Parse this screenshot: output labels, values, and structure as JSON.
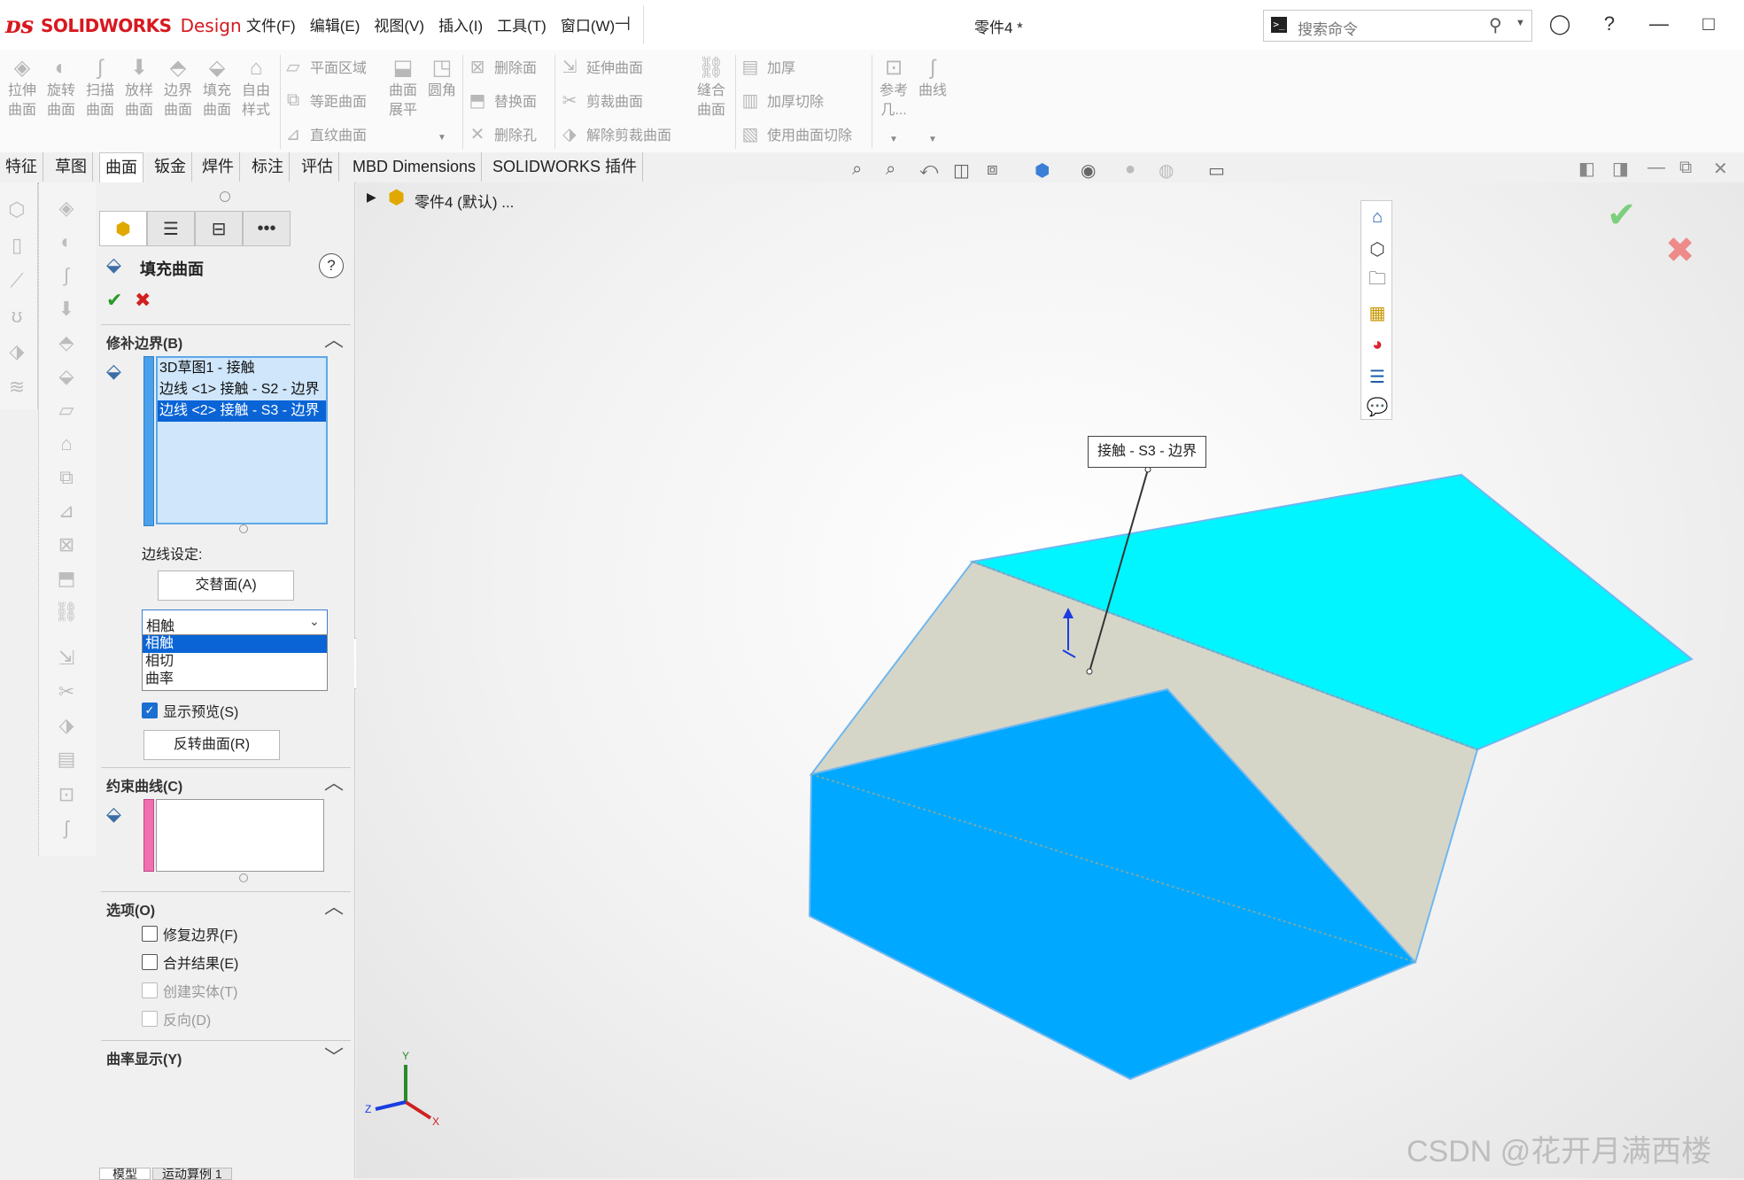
{
  "app": {
    "logo_brand": "SOLIDWORKS",
    "logo_suffix": "Design",
    "document_title": "零件4 *"
  },
  "menu": [
    "文件(F)",
    "编辑(E)",
    "视图(V)",
    "插入(I)",
    "工具(T)",
    "窗口(W)"
  ],
  "search": {
    "placeholder": "搜索命令"
  },
  "ribbon": {
    "big": [
      {
        "l1": "拉伸",
        "l2": "曲面",
        "icon": "extrude-surface-icon"
      },
      {
        "l1": "旋转",
        "l2": "曲面",
        "icon": "revolve-surface-icon"
      },
      {
        "l1": "扫描",
        "l2": "曲面",
        "icon": "sweep-surface-icon"
      },
      {
        "l1": "放样",
        "l2": "曲面",
        "icon": "loft-surface-icon"
      },
      {
        "l1": "边界",
        "l2": "曲面",
        "icon": "boundary-surface-icon"
      },
      {
        "l1": "填充",
        "l2": "曲面",
        "icon": "fill-surface-icon"
      },
      {
        "l1": "自由",
        "l2": "样式",
        "icon": "freeform-icon"
      }
    ],
    "col_a": [
      "平面区域",
      "等距曲面",
      "直纹曲面"
    ],
    "extra_big": [
      {
        "l1": "曲面",
        "l2": "展平",
        "icon": "flatten-icon"
      },
      {
        "l1": "圆角",
        "l2": "",
        "icon": "fillet-icon"
      }
    ],
    "col_b": [
      "删除面",
      "替换面",
      "删除孔"
    ],
    "col_c": [
      "延伸曲面",
      "剪裁曲面",
      "解除剪裁曲面"
    ],
    "knit": {
      "l1": "缝合",
      "l2": "曲面"
    },
    "col_d": [
      "加厚",
      "加厚切除",
      "使用曲面切除"
    ],
    "ref": {
      "l1": "参考",
      "l2": "几..."
    },
    "curves": {
      "l1": "曲线",
      "l2": ""
    }
  },
  "tabs": [
    "特征",
    "草图",
    "曲面",
    "钣金",
    "焊件",
    "标注",
    "评估",
    "MBD Dimensions",
    "SOLIDWORKS 插件"
  ],
  "active_tab": "曲面",
  "tree": {
    "label": "零件4 (默认) ..."
  },
  "pm": {
    "title": "填充曲面",
    "help": "?",
    "ok": "✔",
    "cancel": "✖",
    "sec_boundary": "修补边界(B)",
    "boundary_items": [
      "3D草图1 - 接触",
      "边线 <1> 接触 - S2 - 边界",
      "边线 <2> 接触 - S3 - 边界"
    ],
    "edge_settings": "边线设定:",
    "alt_face_btn": "交替面(A)",
    "combo_value": "相触",
    "combo_options": [
      "相触",
      "相切",
      "曲率"
    ],
    "show_preview": "显示预览(S)",
    "flip_btn": "反转曲面(R)",
    "sec_constraint": "约束曲线(C)",
    "sec_options": "选项(O)",
    "options": [
      {
        "label": "修复边界(F)",
        "enabled": true
      },
      {
        "label": "合并结果(E)",
        "enabled": true
      },
      {
        "label": "创建实体(T)",
        "enabled": false
      },
      {
        "label": "反向(D)",
        "enabled": false
      }
    ],
    "sec_curvature": "曲率显示(Y)"
  },
  "viewport": {
    "callout": "接触 - S3 - 边界",
    "triad": {
      "x": "X",
      "y": "Y",
      "z": "Z"
    },
    "colors": {
      "cyan_face": "#00F5FF",
      "blue_face": "#00A8FF",
      "fill_face": "#D6D6C8",
      "edge": "#6FB7F0"
    }
  },
  "bottom_tabs": [
    "模型",
    "运动算例 1"
  ],
  "watermark": "CSDN @花开月满西楼"
}
